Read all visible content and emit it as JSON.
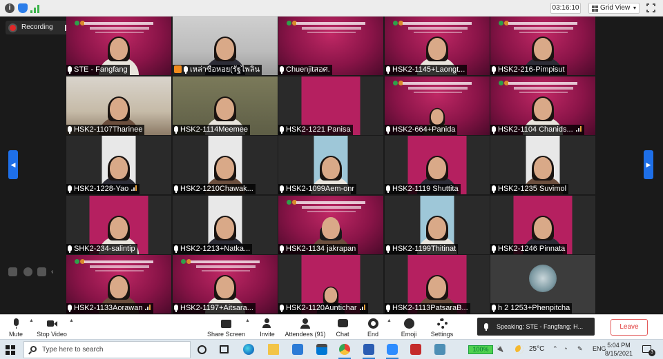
{
  "meeting": {
    "timer": "03:16:10",
    "view_mode": "Grid View",
    "recording_label": "Recording"
  },
  "tiles": [
    {
      "name": "STE - Fangfang",
      "muted": false,
      "host": false,
      "signal": false,
      "active": true
    },
    {
      "name": "เหล่าซือหอย(รัฐไพลิน",
      "muted": false,
      "host": true,
      "signal": false,
      "active": false
    },
    {
      "name": "Chuenjitสอศ.",
      "muted": true,
      "host": false,
      "signal": false,
      "active": false
    },
    {
      "name": "HSK2-1145+Laongt...",
      "muted": true,
      "host": false,
      "signal": false,
      "active": false
    },
    {
      "name": "HSK2-216-Pimpisut",
      "muted": true,
      "host": false,
      "signal": false,
      "active": false
    },
    {
      "name": "HSK2-1107Tharinee",
      "muted": true,
      "host": false,
      "signal": false,
      "active": false
    },
    {
      "name": "HSK2-1114Meemee",
      "muted": true,
      "host": false,
      "signal": false,
      "active": false
    },
    {
      "name": "HSK2-1221 Panisa",
      "muted": true,
      "host": false,
      "signal": false,
      "active": false
    },
    {
      "name": "HSK2-664+Panida",
      "muted": true,
      "host": false,
      "signal": false,
      "active": false
    },
    {
      "name": "HSK2-1104 Chanids...",
      "muted": true,
      "host": false,
      "signal": true,
      "active": false
    },
    {
      "name": "HSK2-1228-Yao",
      "muted": true,
      "host": false,
      "signal": true,
      "active": false
    },
    {
      "name": "HSK2-1210Chawak...",
      "muted": true,
      "host": false,
      "signal": false,
      "active": false
    },
    {
      "name": "HSK2-1099Aem-onr",
      "muted": true,
      "host": false,
      "signal": false,
      "active": false
    },
    {
      "name": "HSK2-1119 Shuttita",
      "muted": true,
      "host": false,
      "signal": false,
      "active": false
    },
    {
      "name": "HSK2-1235 Suvimol",
      "muted": true,
      "host": false,
      "signal": false,
      "active": false
    },
    {
      "name": "SHK2-234-salintip",
      "muted": true,
      "host": false,
      "signal": false,
      "active": false
    },
    {
      "name": "HSK2-1213+Natka...",
      "muted": true,
      "host": false,
      "signal": false,
      "active": false
    },
    {
      "name": "HSK2-1134 jakrapan",
      "muted": true,
      "host": false,
      "signal": false,
      "active": false
    },
    {
      "name": "HSK2-1199Thitinat",
      "muted": true,
      "host": false,
      "signal": false,
      "active": false
    },
    {
      "name": "HSK2-1246 Pinnata",
      "muted": true,
      "host": false,
      "signal": false,
      "active": false
    },
    {
      "name": "HSK2-1133Aorawan",
      "muted": true,
      "host": false,
      "signal": true,
      "active": false
    },
    {
      "name": "HSK2-1197+Aitsara...",
      "muted": true,
      "host": false,
      "signal": false,
      "active": false
    },
    {
      "name": "HSK2-1120Auntichar",
      "muted": true,
      "host": false,
      "signal": true,
      "active": false
    },
    {
      "name": "HSK2-1113PatsaraB...",
      "muted": true,
      "host": false,
      "signal": false,
      "active": false
    },
    {
      "name": "h 2 1253+Phenpitcha",
      "muted": true,
      "host": false,
      "signal": false,
      "active": false
    }
  ],
  "toolbar": {
    "mute": "Mute",
    "stop_video": "Stop Video",
    "share_screen": "Share Screen",
    "invite": "Invite",
    "attendees": "Attendees (91)",
    "chat": "Chat",
    "end": "End",
    "emoji": "Emoji",
    "settings": "Settings",
    "speaking": "Speaking: STE - Fangfang; H...",
    "leave": "Leave"
  },
  "taskbar": {
    "search_placeholder": "Type here to search",
    "battery": "100%",
    "temperature": "25°C",
    "language": "ENG",
    "time": "5:04 PM",
    "date": "8/15/2021",
    "notifications": "3"
  },
  "colors": {
    "active_speaker": "#7ad342",
    "zoom_blue": "#1e6fe8",
    "leave_red": "#e03a3a",
    "recording_red": "#e02828"
  }
}
